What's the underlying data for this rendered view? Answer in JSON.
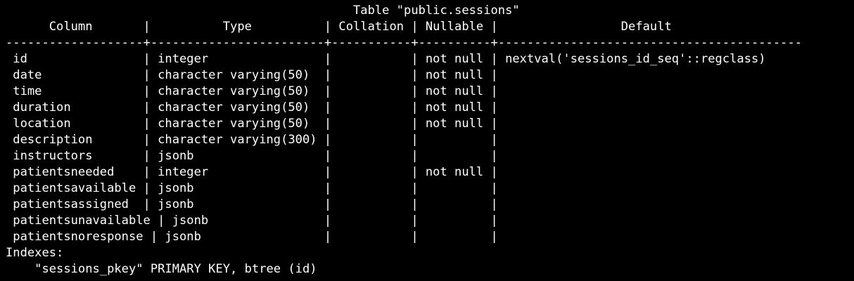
{
  "terminal": {
    "background": "#000000",
    "foreground": "#ffffff",
    "lines": [
      "                                                Table \"public.sessions\"",
      "      Column       |          Type          | Collation | Nullable |                 Default",
      "-------------------+------------------------+-----------+----------+------------------------------------------",
      " id                | integer                |           | not null | nextval('sessions_id_seq'::regclass)",
      " date              | character varying(50)  |           | not null |",
      " time              | character varying(50)  |           | not null |",
      " duration          | character varying(50)  |           | not null |",
      " location          | character varying(50)  |           | not null |",
      " description       | character varying(300) |           |          |",
      " instructors       | jsonb                  |           |          |",
      " patientsneeded    | integer                |           | not null |",
      " patientsavailable | jsonb                  |           |          |",
      " patientsassigned  | jsonb                  |           |          |",
      " patientsunavailable | jsonb                |           |          |",
      " patientsnoresponse | jsonb                 |           |          |",
      "Indexes:",
      "    \"sessions_pkey\" PRIMARY KEY, btree (id)"
    ]
  }
}
